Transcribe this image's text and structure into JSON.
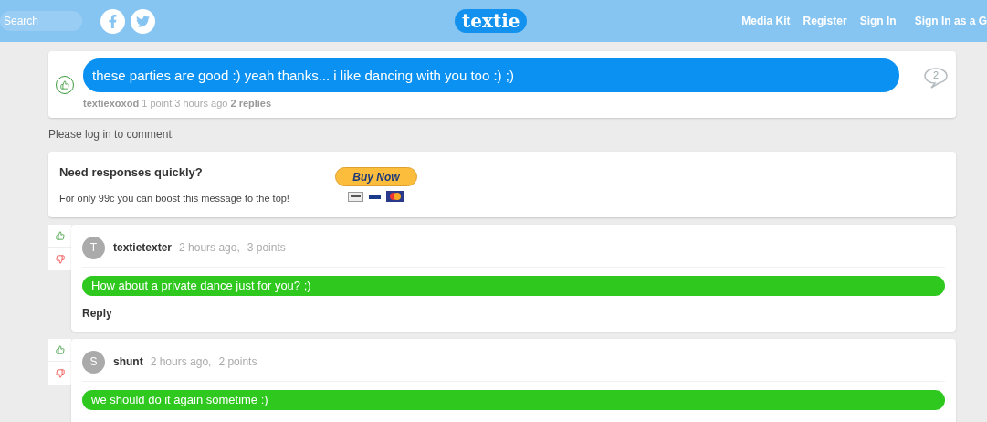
{
  "header": {
    "search": {
      "placeholder": "Search"
    },
    "logo": "textie",
    "nav": [
      "Media Kit",
      "Register",
      "Sign In",
      "Sign In as a G"
    ]
  },
  "post": {
    "message": "these parties are good :) yeah thanks... i like dancing with you too :) ;)",
    "author": "textiexoxod",
    "points": "1 point",
    "time": "3 hours ago",
    "replies": "2 replies",
    "reply_count": "2"
  },
  "login_prompt": {
    "before": "Please ",
    "link": "log in",
    "after": " to comment."
  },
  "promo": {
    "title": "Need responses quickly?",
    "text": "For only 99c you can boost this message to the top!",
    "button": "Buy Now"
  },
  "comments": [
    {
      "initial": "T",
      "author": "textietexter",
      "time": "2 hours ago,",
      "points": "3 points",
      "message": "How about a private dance just for you? ;)",
      "reply": "Reply"
    },
    {
      "initial": "S",
      "author": "shunt",
      "time": "2 hours ago,",
      "points": "2 points",
      "message": "we should do it again sometime :)"
    }
  ]
}
